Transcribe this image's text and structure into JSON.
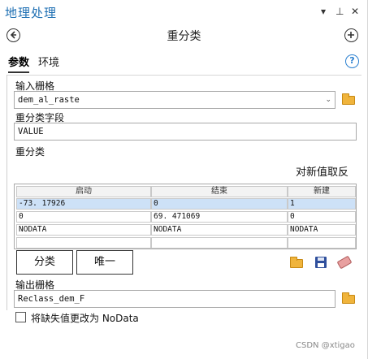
{
  "window": {
    "title": "地理处理",
    "controls": {
      "menu": "▾",
      "pin": "⊥",
      "close": "✕"
    }
  },
  "tool": {
    "back_icon": "back-arrow-icon",
    "title": "重分类",
    "add_icon": "plus-icon"
  },
  "tabs": [
    {
      "label": "参数",
      "active": true
    },
    {
      "label": "环境",
      "active": false
    }
  ],
  "help": "?",
  "input_raster": {
    "label": "输入栅格",
    "value": "dem_al_raste",
    "dropdown": "⌄"
  },
  "reclass_field": {
    "label": "重分类字段",
    "value": "VALUE"
  },
  "reclassification": {
    "label": "重分类",
    "reverse_label": "对新值取反",
    "columns": [
      "启动",
      "结束",
      "新建"
    ],
    "rows": [
      [
        "-73. 17926",
        "0",
        "1"
      ],
      [
        "0",
        "69. 471069",
        "0"
      ],
      [
        "NODATA",
        "NODATA",
        "NODATA"
      ],
      [
        "",
        "",
        ""
      ]
    ]
  },
  "buttons": {
    "classify": "分类",
    "unique": "唯一"
  },
  "output_raster": {
    "label": "输出栅格",
    "value": "Reclass_dem_F"
  },
  "nodata_option": {
    "label": "将缺失值更改为 NoData",
    "checked": false
  },
  "watermark": "CSDN @xtigao",
  "colors": {
    "title": "#1e6fb3",
    "selected_row": "#cde1f7",
    "help": "#2a7fd0",
    "folder": "#f0b43c"
  }
}
